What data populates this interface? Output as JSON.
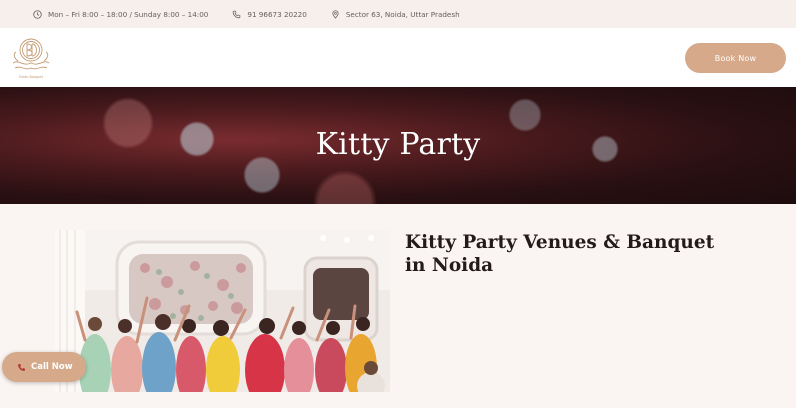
{
  "topbar": {
    "hours": "Mon – Fri 8:00 – 18:00 / Sunday 8:00 – 14:00",
    "phone": "91 96673 20220",
    "location": "Sector 63, Noida, Uttar Pradesh"
  },
  "header": {
    "logo_icon": "monogram-logo",
    "book_label": "Book Now"
  },
  "hero": {
    "title": "Kitty Party"
  },
  "main": {
    "title": "Kitty Party Venues & Banquet in Noida",
    "photo": "group-of-women-celebrating"
  },
  "floating": {
    "call_label": "Call Now"
  },
  "colors": {
    "accent": "#d6a98a",
    "topbar_bg": "#f6efeb",
    "page_bg": "#faf5f2",
    "hero_dark": "#2a1012"
  }
}
